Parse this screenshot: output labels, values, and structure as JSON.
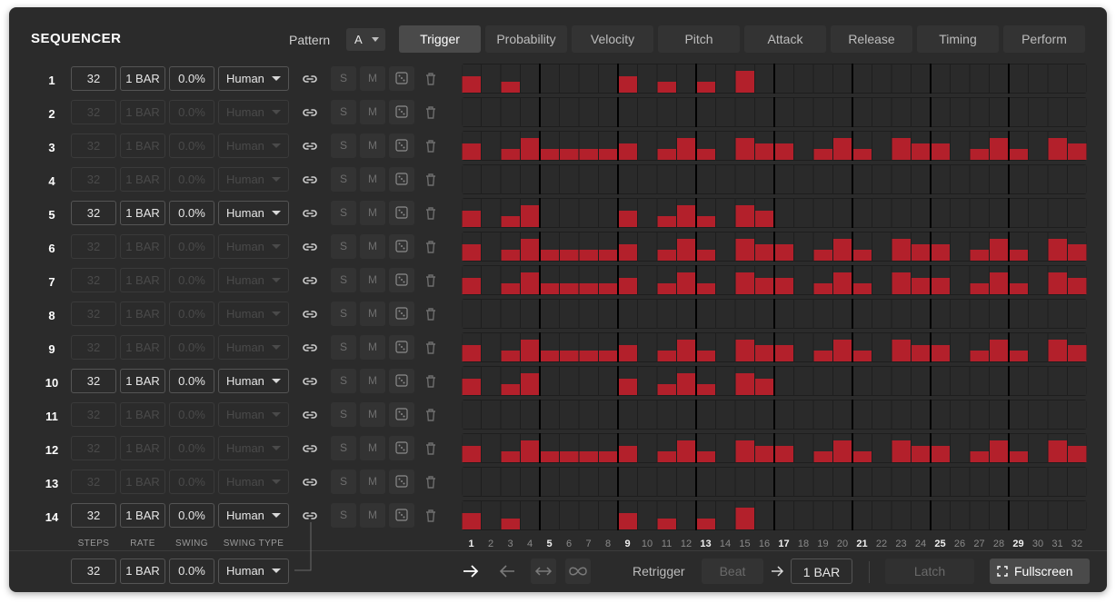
{
  "header": {
    "title": "SEQUENCER",
    "pattern_label": "Pattern",
    "pattern_value": "A"
  },
  "tabs": [
    "Trigger",
    "Probability",
    "Velocity",
    "Pitch",
    "Attack",
    "Release",
    "Timing",
    "Perform"
  ],
  "active_tab": "Trigger",
  "rows": [
    {
      "num": "1",
      "steps": "32",
      "rate": "1 BAR",
      "swing": "0.0%",
      "swing_type": "Human",
      "enabled": true,
      "s": "S",
      "m": "M"
    },
    {
      "num": "2",
      "steps": "32",
      "rate": "1 BAR",
      "swing": "0.0%",
      "swing_type": "Human",
      "enabled": false,
      "s": "S",
      "m": "M"
    },
    {
      "num": "3",
      "steps": "32",
      "rate": "1 BAR",
      "swing": "0.0%",
      "swing_type": "Human",
      "enabled": false,
      "s": "S",
      "m": "M"
    },
    {
      "num": "4",
      "steps": "32",
      "rate": "1 BAR",
      "swing": "0.0%",
      "swing_type": "Human",
      "enabled": false,
      "s": "S",
      "m": "M"
    },
    {
      "num": "5",
      "steps": "32",
      "rate": "1 BAR",
      "swing": "0.0%",
      "swing_type": "Human",
      "enabled": true,
      "s": "S",
      "m": "M"
    },
    {
      "num": "6",
      "steps": "32",
      "rate": "1 BAR",
      "swing": "0.0%",
      "swing_type": "Human",
      "enabled": false,
      "s": "S",
      "m": "M"
    },
    {
      "num": "7",
      "steps": "32",
      "rate": "1 BAR",
      "swing": "0.0%",
      "swing_type": "Human",
      "enabled": false,
      "s": "S",
      "m": "M"
    },
    {
      "num": "8",
      "steps": "32",
      "rate": "1 BAR",
      "swing": "0.0%",
      "swing_type": "Human",
      "enabled": false,
      "s": "S",
      "m": "M"
    },
    {
      "num": "9",
      "steps": "32",
      "rate": "1 BAR",
      "swing": "0.0%",
      "swing_type": "Human",
      "enabled": false,
      "s": "S",
      "m": "M"
    },
    {
      "num": "10",
      "steps": "32",
      "rate": "1 BAR",
      "swing": "0.0%",
      "swing_type": "Human",
      "enabled": true,
      "s": "S",
      "m": "M"
    },
    {
      "num": "11",
      "steps": "32",
      "rate": "1 BAR",
      "swing": "0.0%",
      "swing_type": "Human",
      "enabled": false,
      "s": "S",
      "m": "M"
    },
    {
      "num": "12",
      "steps": "32",
      "rate": "1 BAR",
      "swing": "0.0%",
      "swing_type": "Human",
      "enabled": false,
      "s": "S",
      "m": "M"
    },
    {
      "num": "13",
      "steps": "32",
      "rate": "1 BAR",
      "swing": "0.0%",
      "swing_type": "Human",
      "enabled": false,
      "s": "S",
      "m": "M"
    },
    {
      "num": "14",
      "steps": "32",
      "rate": "1 BAR",
      "swing": "0.0%",
      "swing_type": "Human",
      "enabled": true,
      "s": "S",
      "m": "M"
    }
  ],
  "column_headers": {
    "steps": "STEPS",
    "rate": "RATE",
    "swing": "SWING",
    "swing_type": "SWING TYPE"
  },
  "global": {
    "steps": "32",
    "rate": "1 BAR",
    "swing": "0.0%",
    "swing_type": "Human"
  },
  "step_numbers": [
    "1",
    "2",
    "3",
    "4",
    "5",
    "6",
    "7",
    "8",
    "9",
    "10",
    "11",
    "12",
    "13",
    "14",
    "15",
    "16",
    "17",
    "18",
    "19",
    "20",
    "21",
    "22",
    "23",
    "24",
    "25",
    "26",
    "27",
    "28",
    "29",
    "30",
    "31",
    "32"
  ],
  "bold_steps": [
    1,
    5,
    9,
    13,
    17,
    21,
    25,
    29
  ],
  "trigger_levels": [
    [
      0.6,
      0,
      0.4,
      0,
      0,
      0,
      0,
      0,
      0.6,
      0,
      0.4,
      0,
      0.4,
      0,
      0.8,
      0,
      0,
      0,
      0,
      0,
      0,
      0,
      0,
      0,
      0,
      0,
      0,
      0,
      0,
      0,
      0,
      0
    ],
    [
      0,
      0,
      0,
      0,
      0,
      0,
      0,
      0,
      0,
      0,
      0,
      0,
      0,
      0,
      0,
      0,
      0,
      0,
      0,
      0,
      0,
      0,
      0,
      0,
      0,
      0,
      0,
      0,
      0,
      0,
      0,
      0
    ],
    [
      0.6,
      0,
      0.4,
      0.8,
      0.4,
      0.4,
      0.4,
      0.4,
      0.6,
      0,
      0.4,
      0.8,
      0.4,
      0,
      0.8,
      0.6,
      0.6,
      0,
      0.4,
      0.8,
      0.4,
      0,
      0.8,
      0.6,
      0.6,
      0,
      0.4,
      0.8,
      0.4,
      0,
      0.8,
      0.6
    ],
    [
      0,
      0,
      0,
      0,
      0,
      0,
      0,
      0,
      0,
      0,
      0,
      0,
      0,
      0,
      0,
      0,
      0,
      0,
      0,
      0,
      0,
      0,
      0,
      0,
      0,
      0,
      0,
      0,
      0,
      0,
      0,
      0
    ],
    [
      0.6,
      0,
      0.4,
      0.8,
      0,
      0,
      0,
      0,
      0.6,
      0,
      0.4,
      0.8,
      0.4,
      0,
      0.8,
      0.6,
      0,
      0,
      0,
      0,
      0,
      0,
      0,
      0,
      0,
      0,
      0,
      0,
      0,
      0,
      0,
      0
    ],
    [
      0.6,
      0,
      0.4,
      0.8,
      0.4,
      0.4,
      0.4,
      0.4,
      0.6,
      0,
      0.4,
      0.8,
      0.4,
      0,
      0.8,
      0.6,
      0.6,
      0,
      0.4,
      0.8,
      0.4,
      0,
      0.8,
      0.6,
      0.6,
      0,
      0.4,
      0.8,
      0.4,
      0,
      0.8,
      0.6
    ],
    [
      0.6,
      0,
      0.4,
      0.8,
      0.4,
      0.4,
      0.4,
      0.4,
      0.6,
      0,
      0.4,
      0.8,
      0.4,
      0,
      0.8,
      0.6,
      0.6,
      0,
      0.4,
      0.8,
      0.4,
      0,
      0.8,
      0.6,
      0.6,
      0,
      0.4,
      0.8,
      0.4,
      0,
      0.8,
      0.6
    ],
    [
      0,
      0,
      0,
      0,
      0,
      0,
      0,
      0,
      0,
      0,
      0,
      0,
      0,
      0,
      0,
      0,
      0,
      0,
      0,
      0,
      0,
      0,
      0,
      0,
      0,
      0,
      0,
      0,
      0,
      0,
      0,
      0
    ],
    [
      0.6,
      0,
      0.4,
      0.8,
      0.4,
      0.4,
      0.4,
      0.4,
      0.6,
      0,
      0.4,
      0.8,
      0.4,
      0,
      0.8,
      0.6,
      0.6,
      0,
      0.4,
      0.8,
      0.4,
      0,
      0.8,
      0.6,
      0.6,
      0,
      0.4,
      0.8,
      0.4,
      0,
      0.8,
      0.6
    ],
    [
      0.6,
      0,
      0.4,
      0.8,
      0,
      0,
      0,
      0,
      0.6,
      0,
      0.4,
      0.8,
      0.4,
      0,
      0.8,
      0.6,
      0,
      0,
      0,
      0,
      0,
      0,
      0,
      0,
      0,
      0,
      0,
      0,
      0,
      0,
      0,
      0
    ],
    [
      0,
      0,
      0,
      0,
      0,
      0,
      0,
      0,
      0,
      0,
      0,
      0,
      0,
      0,
      0,
      0,
      0,
      0,
      0,
      0,
      0,
      0,
      0,
      0,
      0,
      0,
      0,
      0,
      0,
      0,
      0,
      0
    ],
    [
      0.6,
      0,
      0.4,
      0.8,
      0.4,
      0.4,
      0.4,
      0.4,
      0.6,
      0,
      0.4,
      0.8,
      0.4,
      0,
      0.8,
      0.6,
      0.6,
      0,
      0.4,
      0.8,
      0.4,
      0,
      0.8,
      0.6,
      0.6,
      0,
      0.4,
      0.8,
      0.4,
      0,
      0.8,
      0.6
    ],
    [
      0,
      0,
      0,
      0,
      0,
      0,
      0,
      0,
      0,
      0,
      0,
      0,
      0,
      0,
      0,
      0,
      0,
      0,
      0,
      0,
      0,
      0,
      0,
      0,
      0,
      0,
      0,
      0,
      0,
      0,
      0,
      0
    ],
    [
      0.6,
      0,
      0.4,
      0,
      0,
      0,
      0,
      0,
      0.6,
      0,
      0.4,
      0,
      0.4,
      0,
      0.8,
      0,
      0,
      0,
      0,
      0,
      0,
      0,
      0,
      0,
      0,
      0,
      0,
      0,
      0,
      0,
      0,
      0
    ]
  ],
  "transport": {
    "retrigger_label": "Retrigger",
    "beat_label": "Beat",
    "rate": "1 BAR",
    "latch_label": "Latch",
    "fullscreen_label": "Fullscreen"
  },
  "colors": {
    "step_active": "#b3202b",
    "step_cell": "#2a2a2a",
    "beat_divider": "#000000"
  }
}
